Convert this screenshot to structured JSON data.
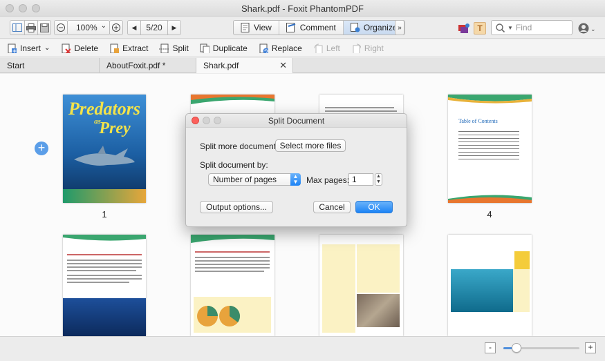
{
  "window": {
    "title": "Shark.pdf - Foxit PhantomPDF"
  },
  "toolbar": {
    "zoom": "100%",
    "page_indicator": "5/20",
    "modes": [
      {
        "label": "View",
        "active": false
      },
      {
        "label": "Comment",
        "active": false
      },
      {
        "label": "Organize",
        "active": true
      }
    ],
    "search_placeholder": "Find"
  },
  "organize_toolbar": {
    "insert": "Insert",
    "delete": "Delete",
    "extract": "Extract",
    "split": "Split",
    "duplicate": "Duplicate",
    "replace": "Replace",
    "left": "Left",
    "right": "Right"
  },
  "tabs": [
    {
      "label": "Start",
      "active": false
    },
    {
      "label": "AboutFoxit.pdf *",
      "active": false
    },
    {
      "label": "Shark.pdf",
      "active": true
    }
  ],
  "pages": {
    "cover_title_line1": "Predators",
    "cover_title_line2": "as",
    "cover_title_line3": "Prey",
    "label_1": "1",
    "label_4": "4",
    "toc_title": "Table of Contents"
  },
  "dialog": {
    "title": "Split Document",
    "split_more_label": "Split more document:",
    "select_files_button": "Select more files",
    "split_by_label": "Split document by:",
    "split_by_value": "Number of pages",
    "max_pages_label": "Max pages:",
    "max_pages_value": "1",
    "output_options_button": "Output options...",
    "cancel_button": "Cancel",
    "ok_button": "OK"
  },
  "statusbar": {
    "zoom_out": "-",
    "zoom_in": "+",
    "zoom_level_fraction": 0.12
  },
  "colors": {
    "accent": "#1d83f5",
    "organize_active": "#c9daf0"
  }
}
